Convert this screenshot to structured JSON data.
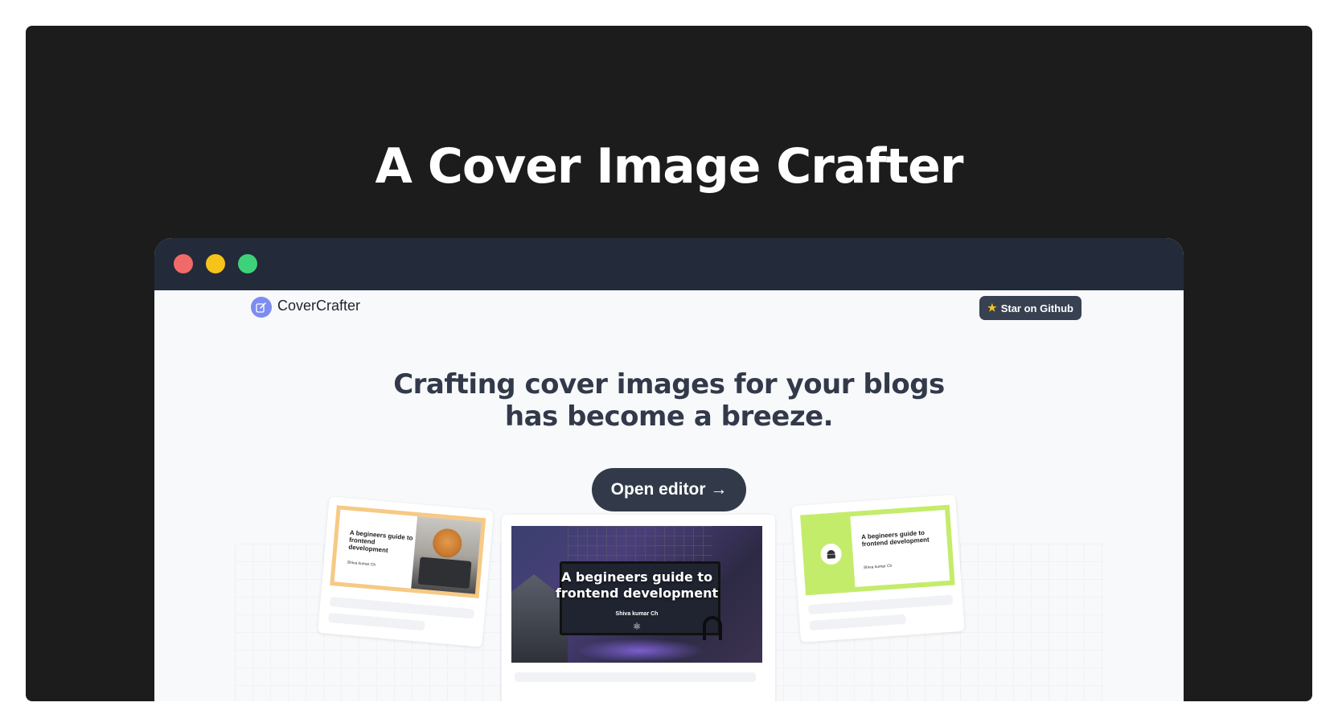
{
  "banner": {
    "title": "A Cover Image Crafter"
  },
  "window_controls": [
    "close",
    "minimize",
    "maximize"
  ],
  "navbar": {
    "brand": "CoverCrafter",
    "github_button": "Star on Github"
  },
  "hero": {
    "title_line1": "Crafting cover images for your blogs",
    "title_line2": "has become a breeze.",
    "cta": "Open editor →"
  },
  "previews": [
    {
      "title": "A begineers guide to frontend development",
      "author": "Shiva kumar Ch",
      "accent": "#f7c984"
    },
    {
      "title": "A begineers guide to frontend development",
      "author": "Shiva kumar Ch",
      "accent": "#4b3f7a"
    },
    {
      "title": "A begineers guide to frontend development",
      "author": "Shiva kumar Ch",
      "accent": "#c4ec6b"
    }
  ],
  "icons": {
    "logo": "edit-icon",
    "github_star": "star-icon",
    "tech_center": "react-icon",
    "tech_right": "android-icon"
  },
  "colors": {
    "banner_bg": "#1c1c1c",
    "titlebar": "#232a39",
    "button_dark": "#323a4a",
    "close": "#f06a6a",
    "minimize": "#f6c31b",
    "maximize": "#3dd27a"
  }
}
